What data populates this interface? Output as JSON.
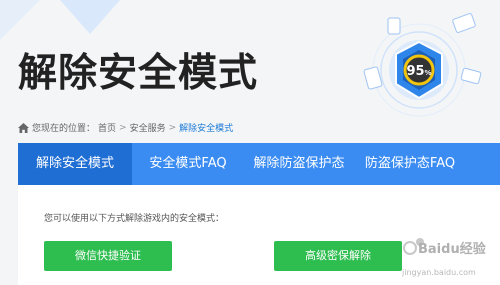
{
  "page": {
    "title": "解除安全模式"
  },
  "breadcrumb": {
    "prefix": "您现在的位置：",
    "items": [
      "首页",
      "安全服务",
      "解除安全模式"
    ],
    "separator": ">"
  },
  "score": {
    "value": "95",
    "unit": "%"
  },
  "tabs": [
    {
      "label": "解除安全模式",
      "active": true
    },
    {
      "label": "安全模式FAQ",
      "active": false
    },
    {
      "label": "解除防盗保护态",
      "active": false
    },
    {
      "label": "防盗保护态FAQ",
      "active": false
    }
  ],
  "content": {
    "instruction": "您可以使用以下方式解除游戏内的安全模式：",
    "buttons": [
      "微信快捷验证",
      "高级密保解除"
    ]
  },
  "watermark": {
    "text": "Baidu经验",
    "url": "jingyan.baidu.com"
  },
  "colors": {
    "tab_bar": "#3b8cf2",
    "tab_active": "#1f6ed4",
    "button": "#2ebd4f",
    "link": "#1a7bd6"
  }
}
